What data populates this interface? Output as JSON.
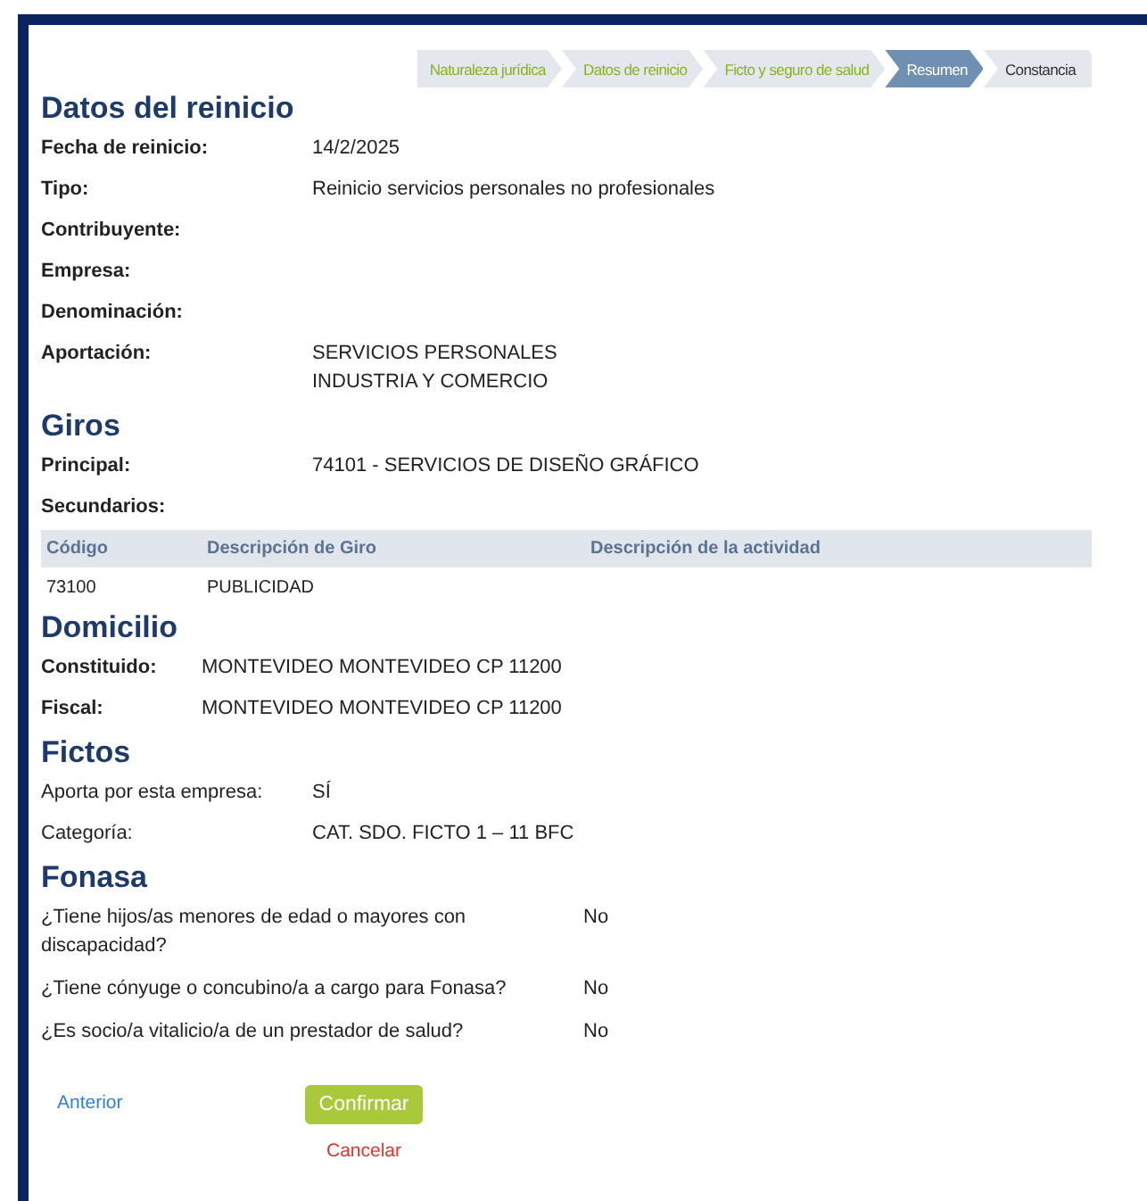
{
  "steps": [
    {
      "label": "Naturaleza jurídica",
      "selected": false,
      "done": true
    },
    {
      "label": "Datos de reinicio",
      "selected": false,
      "done": true
    },
    {
      "label": "Ficto y seguro de salud",
      "selected": false,
      "done": true
    },
    {
      "label": "Resumen",
      "selected": true,
      "done": false
    },
    {
      "label": "Constancia",
      "selected": false,
      "done": false
    }
  ],
  "sections": [
    {
      "title": "Datos del reinicio",
      "kind": "standard",
      "items": [
        {
          "kind": "row",
          "label": "Fecha de reinicio:",
          "values": [
            "14/2/2025"
          ]
        },
        {
          "kind": "row",
          "label": "Tipo:",
          "values": [
            "Reinicio servicios personales no profesionales"
          ]
        },
        {
          "kind": "row",
          "label": "Contribuyente:"
        },
        {
          "kind": "row",
          "label": "Empresa:"
        },
        {
          "kind": "row",
          "label": "Denominación:"
        },
        {
          "kind": "row",
          "label": "Aportación:",
          "values": [
            "SERVICIOS PERSONALES",
            "INDUSTRIA Y COMERCIO"
          ]
        }
      ]
    },
    {
      "title": "Giros",
      "kind": "standard",
      "items": [
        {
          "kind": "row",
          "label": "Principal:",
          "values": [
            "74101 - SERVICIOS DE DISEÑO GRÁFICO"
          ]
        },
        {
          "kind": "row",
          "label": "Secundarios:"
        },
        {
          "kind": "table",
          "columns": [
            "Código",
            "Descripción de Giro",
            "Descripción de la actividad"
          ],
          "rows": [
            [
              "73100",
              "PUBLICIDAD",
              ""
            ]
          ]
        }
      ]
    },
    {
      "title": "Domicilio",
      "kind": "narrow",
      "items": [
        {
          "kind": "row",
          "label": "Constituido:",
          "values": [
            "MONTEVIDEO MONTEVIDEO CP 11200"
          ]
        },
        {
          "kind": "row",
          "label": "Fiscal:",
          "values": [
            "MONTEVIDEO MONTEVIDEO CP 11200"
          ]
        }
      ]
    },
    {
      "title": "Fictos",
      "kind": "plain",
      "items": [
        {
          "kind": "row",
          "label": "Aporta por esta empresa:",
          "values": [
            "SÍ"
          ]
        },
        {
          "kind": "row",
          "label": "Categoría:",
          "values": [
            "CAT. SDO. FICTO 1 – 11 BFC"
          ]
        }
      ]
    },
    {
      "title": "Fonasa",
      "kind": "questions",
      "items": [
        {
          "kind": "row",
          "label": "¿Tiene hijos/as menores de edad o mayores con discapacidad?",
          "values": [
            "No"
          ]
        },
        {
          "kind": "row",
          "label": "¿Tiene cónyuge o concubino/a a cargo para Fonasa?",
          "values": [
            "No"
          ]
        },
        {
          "kind": "row",
          "label": "¿Es socio/a vitalicio/a de un prestador de salud?",
          "values": [
            "No"
          ]
        }
      ]
    }
  ],
  "actions": {
    "back": "Anterior",
    "confirm": "Confirmar",
    "cancel": "Cancelar"
  }
}
